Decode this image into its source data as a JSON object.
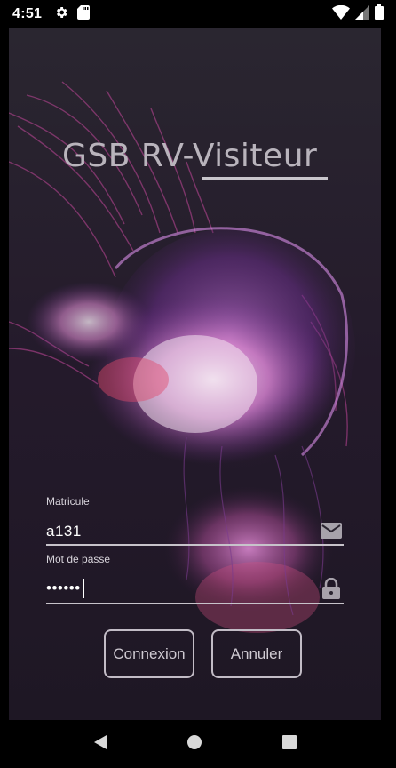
{
  "status_bar": {
    "time": "4:51",
    "left_icons": [
      "settings-icon",
      "sd-card-icon"
    ],
    "right_icons": [
      "wifi-icon",
      "signal-icon",
      "battery-icon"
    ]
  },
  "app": {
    "title": "GSB RV-Visiteur",
    "login": {
      "matricule_label": "Matricule",
      "matricule_value": "a131",
      "password_label": "Mot de passe",
      "password_value": "••••••"
    },
    "buttons": {
      "connect_label": "Connexion",
      "cancel_label": "Annuler"
    }
  },
  "nav_bar": {
    "icons": [
      "back-icon",
      "home-icon",
      "recents-icon"
    ]
  },
  "colors": {
    "background": "#211a26",
    "text_light": "#ffffff",
    "button_border": "#c2bcc6"
  }
}
